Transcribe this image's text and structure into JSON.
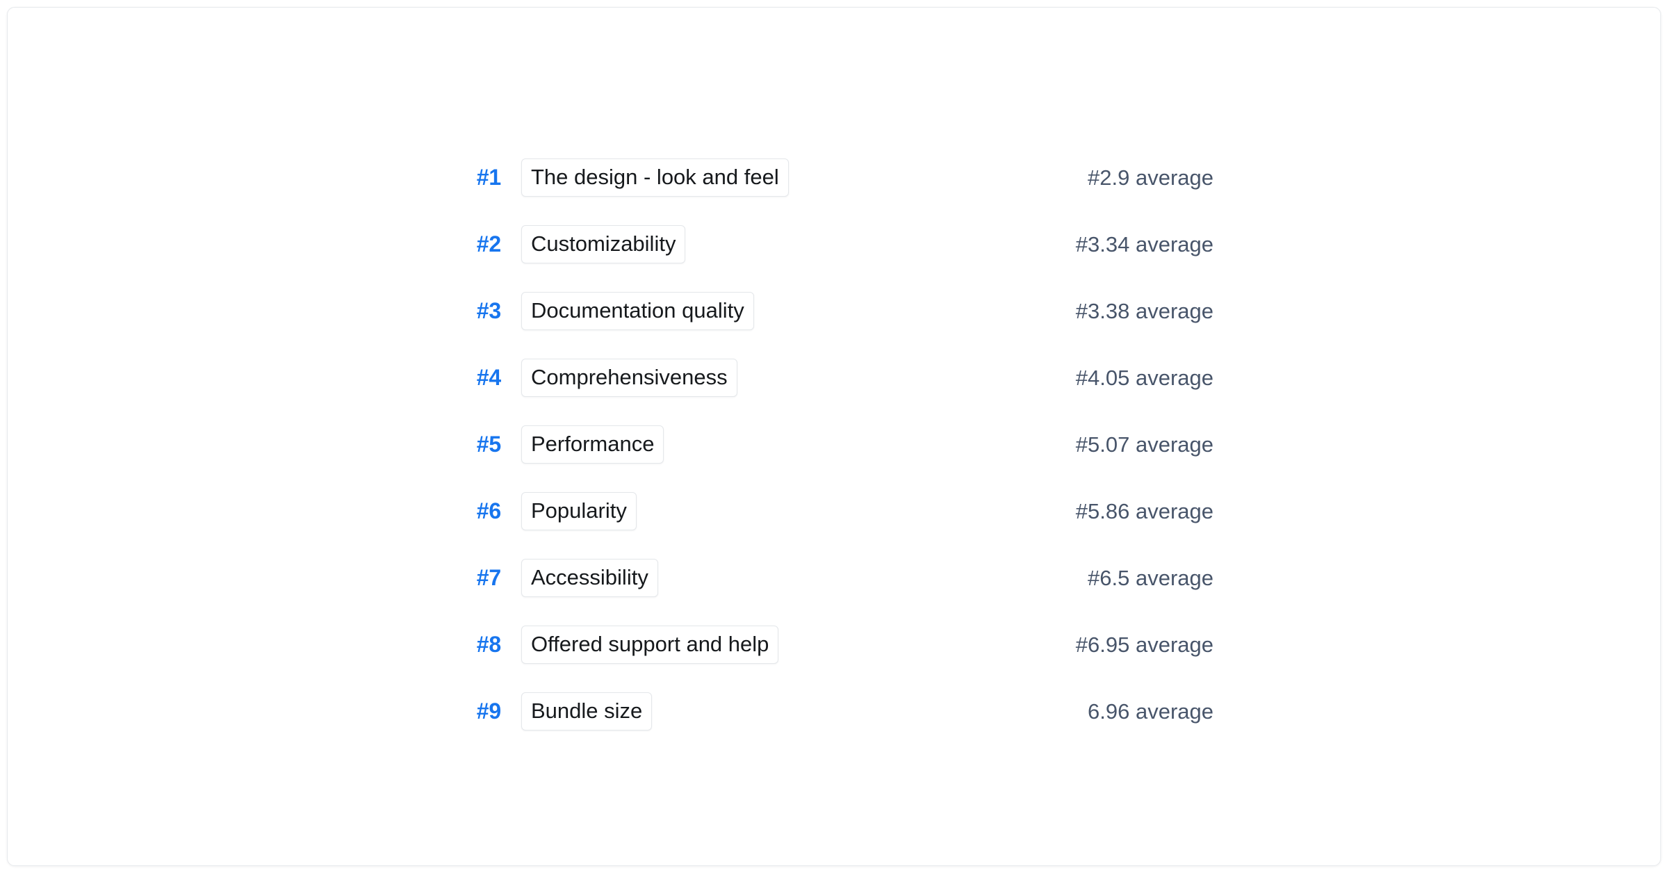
{
  "card": {
    "accent_color": "#1775ee",
    "tag_text_color": "#16191c",
    "average_text_color": "#48556a",
    "border_color": "#e6e9ec",
    "background_color": "#ffffff"
  },
  "ranking": {
    "rows": [
      {
        "rank": "#1",
        "label": "The design - look and feel",
        "average": "#2.9 average"
      },
      {
        "rank": "#2",
        "label": "Customizability",
        "average": "#3.34 average"
      },
      {
        "rank": "#3",
        "label": "Documentation quality",
        "average": "#3.38 average"
      },
      {
        "rank": "#4",
        "label": "Comprehensiveness",
        "average": "#4.05 average"
      },
      {
        "rank": "#5",
        "label": "Performance",
        "average": "#5.07 average"
      },
      {
        "rank": "#6",
        "label": "Popularity",
        "average": "#5.86 average"
      },
      {
        "rank": "#7",
        "label": "Accessibility",
        "average": "#6.5 average"
      },
      {
        "rank": "#8",
        "label": "Offered support and help",
        "average": "#6.95 average"
      },
      {
        "rank": "#9",
        "label": "Bundle size",
        "average": "6.96 average"
      }
    ]
  }
}
